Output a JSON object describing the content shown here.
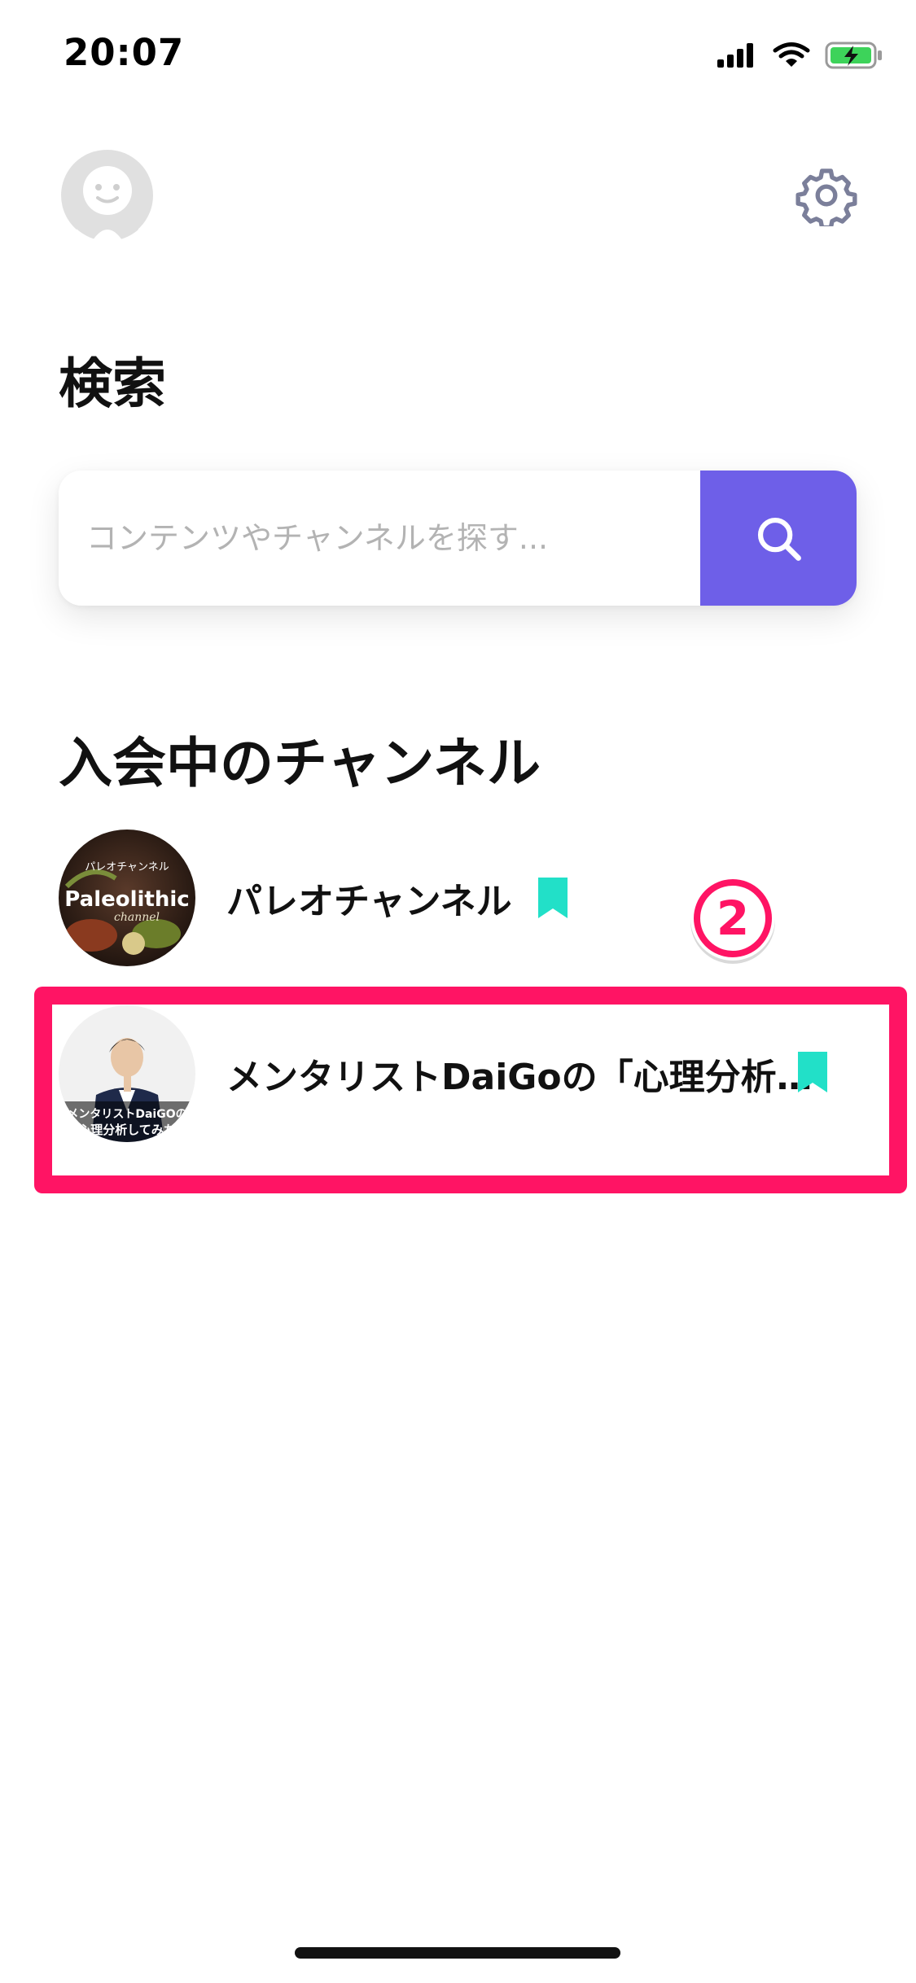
{
  "status_bar": {
    "time": "20:07"
  },
  "header": {
    "avatar_icon": "face-avatar-icon",
    "settings_icon": "gear-icon"
  },
  "search_section": {
    "title": "検索",
    "placeholder": "コンテンツやチャンネルを探す...",
    "button_icon": "search-icon"
  },
  "channels_section": {
    "title": "入会中のチャンネル",
    "items": [
      {
        "name": "パレオチャンネル",
        "thumb_title": "パレオチャンネル",
        "thumb_brand": "Paleolithic",
        "thumb_sub": "channel",
        "bookmarked": true
      },
      {
        "name": "メンタリストDaiGoの「心理分析…",
        "thumb_line1": "メンタリストDaiGOの",
        "thumb_line2": "心理分析してみた",
        "bookmarked": true
      }
    ]
  },
  "annotation": {
    "step_number": "2"
  },
  "colors": {
    "accent": "#6E5FE8",
    "bookmark": "#22E0C8",
    "highlight": "#FF1464"
  }
}
